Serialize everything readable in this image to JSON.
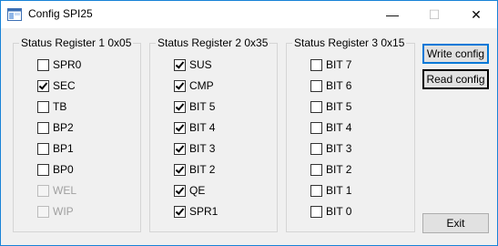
{
  "window": {
    "title": "Config SPI25",
    "controls": {
      "minimize": "—",
      "maximize": "☐",
      "close": "✕"
    }
  },
  "groups": [
    {
      "title": "Status Register 1 0x05",
      "items": [
        {
          "label": "SPR0",
          "checked": false,
          "enabled": true
        },
        {
          "label": "SEC",
          "checked": true,
          "enabled": true
        },
        {
          "label": "TB",
          "checked": false,
          "enabled": true
        },
        {
          "label": "BP2",
          "checked": false,
          "enabled": true
        },
        {
          "label": "BP1",
          "checked": false,
          "enabled": true
        },
        {
          "label": "BP0",
          "checked": false,
          "enabled": true
        },
        {
          "label": "WEL",
          "checked": false,
          "enabled": false
        },
        {
          "label": "WIP",
          "checked": false,
          "enabled": false
        }
      ]
    },
    {
      "title": "Status Register 2 0x35",
      "items": [
        {
          "label": "SUS",
          "checked": true,
          "enabled": true
        },
        {
          "label": "CMP",
          "checked": true,
          "enabled": true
        },
        {
          "label": "BIT 5",
          "checked": true,
          "enabled": true
        },
        {
          "label": "BIT 4",
          "checked": true,
          "enabled": true
        },
        {
          "label": "BIT 3",
          "checked": true,
          "enabled": true
        },
        {
          "label": "BIT 2",
          "checked": true,
          "enabled": true
        },
        {
          "label": "QE",
          "checked": true,
          "enabled": true
        },
        {
          "label": "SPR1",
          "checked": true,
          "enabled": true
        }
      ]
    },
    {
      "title": "Status Register 3 0x15",
      "items": [
        {
          "label": "BIT 7",
          "checked": false,
          "enabled": true
        },
        {
          "label": "BIT 6",
          "checked": false,
          "enabled": true
        },
        {
          "label": "BIT 5",
          "checked": false,
          "enabled": true
        },
        {
          "label": "BIT 4",
          "checked": false,
          "enabled": true
        },
        {
          "label": "BIT 3",
          "checked": false,
          "enabled": true
        },
        {
          "label": "BIT 2",
          "checked": false,
          "enabled": true
        },
        {
          "label": "BIT 1",
          "checked": false,
          "enabled": true
        },
        {
          "label": "BIT 0",
          "checked": false,
          "enabled": true
        }
      ]
    }
  ],
  "buttons": {
    "write": "Write config",
    "read": "Read config",
    "exit": "Exit"
  }
}
